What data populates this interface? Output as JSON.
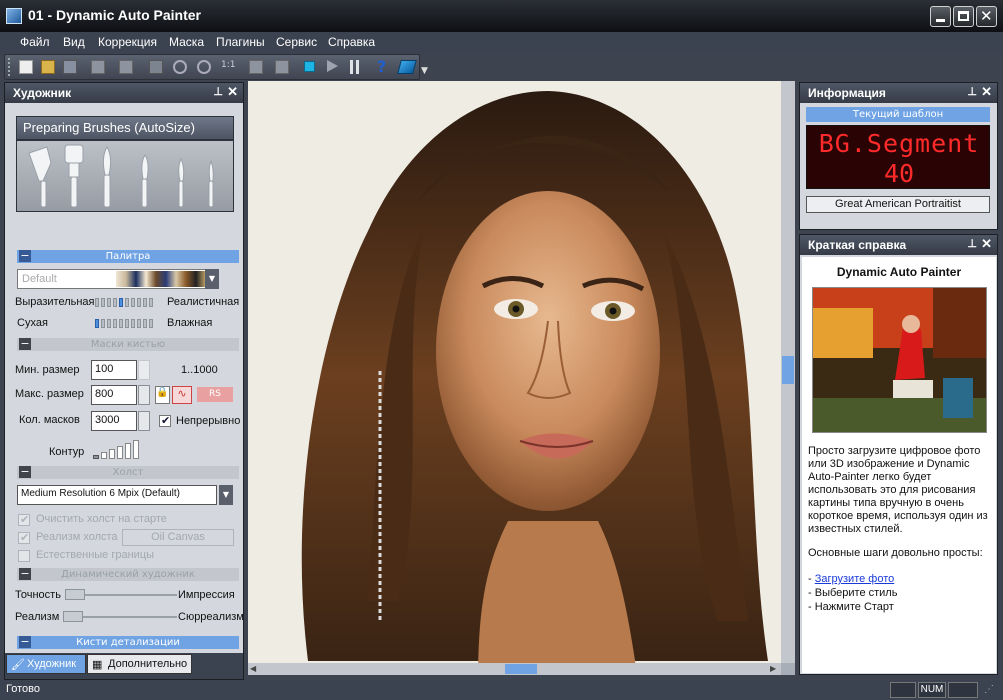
{
  "window": {
    "title": "01 - Dynamic Auto Painter"
  },
  "menu": [
    "Файл",
    "Вид",
    "Коррекция",
    "Маска",
    "Плагины",
    "Сервис",
    "Справка"
  ],
  "toolbar": {
    "zoom_1to1": "1:1"
  },
  "artist_panel": {
    "title": "Художник",
    "preset": "Preparing Brushes (AutoSize)",
    "palette_section": "Палитра",
    "palette_value": "Default",
    "expressive": "Выразительная",
    "realistic": "Реалистичная",
    "dry": "Сухая",
    "wet": "Влажная",
    "brush_masks_section": "Маски кистью",
    "min_size_label": "Мин. размер",
    "min_size_value": "100",
    "range_text": "1..1000",
    "max_size_label": "Макс. размер",
    "max_size_value": "800",
    "rs_label": "RS",
    "masks_count_label": "Кол. масков",
    "masks_count_value": "3000",
    "continuous_label": "Непрерывно",
    "contour_label": "Контур",
    "canvas_section": "Холст",
    "canvas_value": "Medium Resolution 6 Mpix (Default)",
    "clear_canvas_label": "Очистить холст на старте",
    "canvas_realism_label": "Реализм холста",
    "canvas_realism_value": "Oil Canvas",
    "natural_borders_label": "Естественные границы",
    "dynamic_section": "Динамический художник",
    "accuracy_label": "Точность",
    "impression_label": "Импрессия",
    "realism_label": "Реализм",
    "surrealism_label": "Сюрреализм",
    "detail_brushes_section": "Кисти детализации",
    "tabs": [
      "Художник",
      "Дополнительно"
    ]
  },
  "info_panel": {
    "title": "Информация",
    "current_template_label": "Текущий шаблон",
    "led_line1": "BG.Segment",
    "led_line2": "40",
    "style_name": "Great American Portraitist"
  },
  "help_panel": {
    "title": "Краткая справка",
    "heading": "Dynamic Auto Painter",
    "text": "Просто загрузите цифровое фото или 3D изображение и Dynamic Auto-Painter легко будет использовать это для рисования картины типа вручную в очень короткое время, используя один из известных стилей.",
    "steps_title": "Основные шаги довольно просты:",
    "step1_link": "Загрузите фото",
    "step2": "Выберите стиль",
    "step3": "Нажмите Старт"
  },
  "statusbar": {
    "text": "Готово",
    "num": "NUM"
  },
  "colors": {
    "accent": "#6fa3e4",
    "panel_bg": "#d4d8de",
    "frame": "#3c4350",
    "led_red": "#ff2a2a"
  }
}
